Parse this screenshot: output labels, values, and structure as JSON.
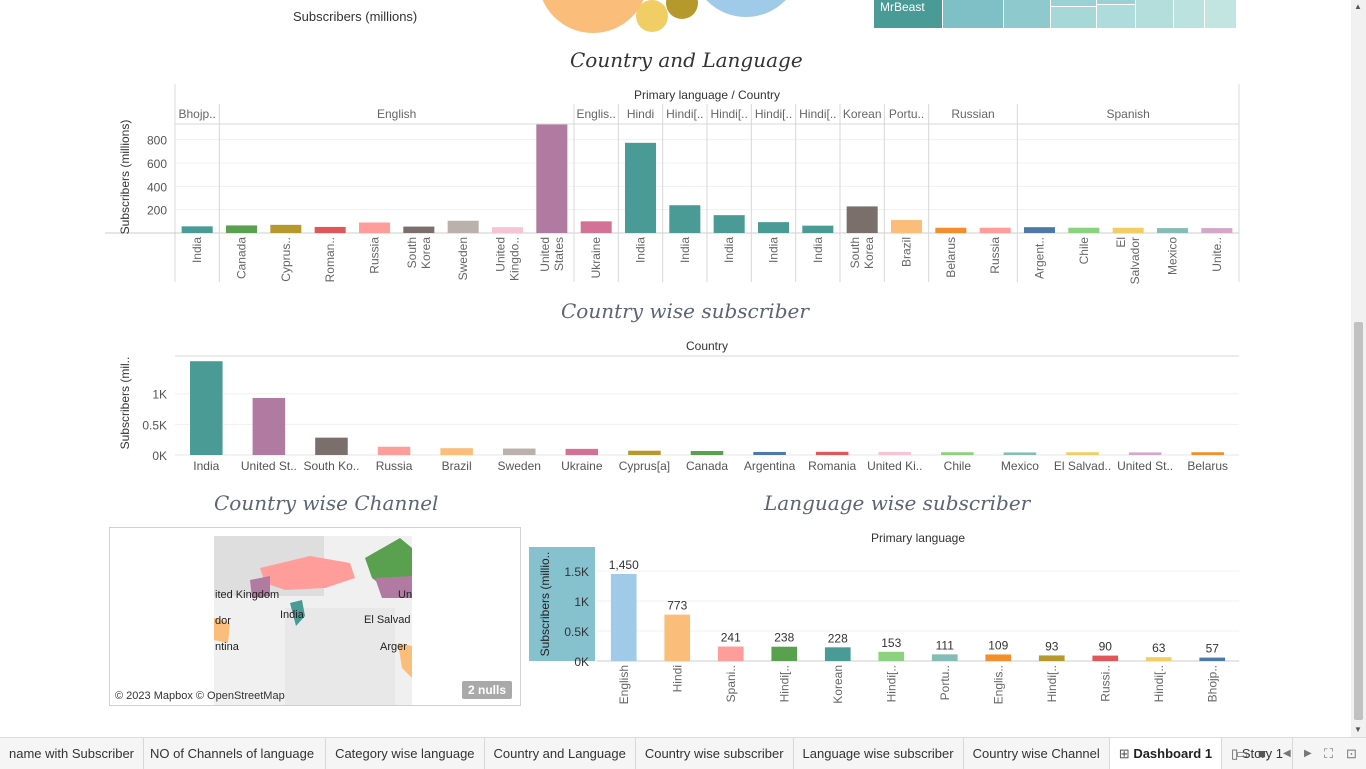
{
  "top_strip": {
    "axis_label": "Subscribers (millions)",
    "treemap_label": "MrBeast"
  },
  "titles": {
    "country_language": "Country and Language",
    "country_subscriber": "Country wise subscriber",
    "country_channel": "Country wise Channel",
    "language_subscriber": "Language wise subscriber"
  },
  "colors": {
    "teal": "#4a9a95",
    "mauve": "#b07aa1",
    "grey_brown": "#7a6f6a",
    "pink": "#ff9d9a",
    "orange": "#fabd7a",
    "taupe": "#bab0ac",
    "rose": "#d37295",
    "olive": "#b6992d",
    "green": "#59a14f",
    "blue": "#4e79a7",
    "red": "#e15759",
    "light_pink": "#f7c4d5",
    "light_green": "#8cd17d",
    "light_teal": "#86bcb6",
    "yellow": "#f1ce63",
    "lavender": "#d4a6c8",
    "dark_orange": "#f28e2b",
    "light_blue": "#a0cbe8",
    "highlight": "#86c2ce"
  },
  "chart_data": [
    {
      "type": "bar",
      "title": "Country and Language",
      "header": "Primary language  /  Country",
      "ylabel": "Subscribers (millions)",
      "yticks": [
        "200",
        "400",
        "600",
        "800"
      ],
      "ylim": [
        0,
        950
      ],
      "groups": [
        {
          "name": "Bhojp..",
          "bars": [
            {
              "x": "India",
              "value": 57,
              "color": "#4a9a95"
            }
          ]
        },
        {
          "name": "English",
          "bars": [
            {
              "x": "Canada",
              "value": 65,
              "color": "#59a14f"
            },
            {
              "x": "Cyprus..",
              "value": 70,
              "color": "#b6992d"
            },
            {
              "x": "Roman..",
              "value": 52,
              "color": "#e15759"
            },
            {
              "x": "Russia",
              "value": 90,
              "color": "#ff9d9a"
            },
            {
              "x": "South Korea",
              "value": 55,
              "color": "#7a6f6a"
            },
            {
              "x": "Sweden",
              "value": 105,
              "color": "#bab0ac"
            },
            {
              "x": "United Kingdo..",
              "value": 50,
              "color": "#f7c4d5"
            },
            {
              "x": "United States",
              "value": 930,
              "color": "#b07aa1"
            }
          ]
        },
        {
          "name": "Englis..",
          "bars": [
            {
              "x": "Ukraine",
              "value": 100,
              "color": "#d37295"
            }
          ]
        },
        {
          "name": "Hindi",
          "bars": [
            {
              "x": "India",
              "value": 773,
              "color": "#4a9a95"
            }
          ]
        },
        {
          "name": "Hindi[..",
          "bars": [
            {
              "x": "India",
              "value": 238,
              "color": "#4a9a95"
            }
          ]
        },
        {
          "name": "Hindi[..",
          "bars": [
            {
              "x": "India",
              "value": 153,
              "color": "#4a9a95"
            }
          ]
        },
        {
          "name": "Hindi[..",
          "bars": [
            {
              "x": "India",
              "value": 93,
              "color": "#4a9a95"
            }
          ]
        },
        {
          "name": "Hindi[..",
          "bars": [
            {
              "x": "India",
              "value": 63,
              "color": "#4a9a95"
            }
          ]
        },
        {
          "name": "Korean",
          "bars": [
            {
              "x": "South Korea",
              "value": 228,
              "color": "#7a6f6a"
            }
          ]
        },
        {
          "name": "Portu..",
          "bars": [
            {
              "x": "Brazil",
              "value": 111,
              "color": "#fabd7a"
            }
          ]
        },
        {
          "name": "Russian",
          "bars": [
            {
              "x": "Belarus",
              "value": 45,
              "color": "#f28e2b"
            },
            {
              "x": "Russia",
              "value": 45,
              "color": "#ff9d9a"
            }
          ]
        },
        {
          "name": "Spanish",
          "bars": [
            {
              "x": "Argent..",
              "value": 50,
              "color": "#4e79a7"
            },
            {
              "x": "Chile",
              "value": 45,
              "color": "#8cd17d"
            },
            {
              "x": "El Salvador",
              "value": 45,
              "color": "#f1ce63"
            },
            {
              "x": "Mexico",
              "value": 42,
              "color": "#86bcb6"
            },
            {
              "x": "Unite..",
              "value": 42,
              "color": "#d4a6c8"
            }
          ]
        }
      ]
    },
    {
      "type": "bar",
      "title": "Country wise subscriber",
      "header": "Country",
      "ylabel": "Subscribers (mil..",
      "yticks": [
        "0K",
        "0.5K",
        "1K"
      ],
      "ylim": [
        0,
        1550
      ],
      "categories": [
        "India",
        "United St..",
        "South Ko..",
        "Russia",
        "Brazil",
        "Sweden",
        "Ukraine",
        "Cyprus[a]",
        "Canada",
        "Argentina",
        "Romania",
        "United Ki..",
        "Chile",
        "Mexico",
        "El Salvad..",
        "United St..",
        "Belarus"
      ],
      "values": [
        1530,
        930,
        283,
        135,
        111,
        105,
        100,
        70,
        65,
        50,
        52,
        50,
        45,
        42,
        45,
        42,
        45
      ],
      "colors": [
        "#4a9a95",
        "#b07aa1",
        "#7a6f6a",
        "#ff9d9a",
        "#fabd7a",
        "#bab0ac",
        "#d37295",
        "#b6992d",
        "#59a14f",
        "#4e79a7",
        "#e15759",
        "#f7c4d5",
        "#8cd17d",
        "#86bcb6",
        "#f1ce63",
        "#d4a6c8",
        "#f28e2b"
      ]
    },
    {
      "type": "bar",
      "title": "Language wise subscriber",
      "header": "Primary language",
      "ylabel": "Subscribers (millio..",
      "yticks": [
        "0K",
        "0.5K",
        "1K",
        "1.5K"
      ],
      "ylim": [
        0,
        1750
      ],
      "categories": [
        "English",
        "Hindi",
        "Spani..",
        "Hindi[..",
        "Korean",
        "Hindi[..",
        "Portu..",
        "Englis..",
        "Hindi[..",
        "Russi..",
        "Hindi[..",
        "Bhojp.."
      ],
      "values": [
        1450,
        773,
        241,
        238,
        228,
        153,
        111,
        109,
        93,
        90,
        63,
        57
      ],
      "labels": [
        "1,450",
        "773",
        "241",
        "238",
        "228",
        "153",
        "111",
        "109",
        "93",
        "90",
        "63",
        "57"
      ],
      "colors": [
        "#a0cbe8",
        "#fabd7a",
        "#ff9d9a",
        "#59a14f",
        "#4a9a95",
        "#8cd17d",
        "#86bcb6",
        "#f28e2b",
        "#b6992d",
        "#e15759",
        "#f1ce63",
        "#4e79a7"
      ]
    }
  ],
  "map": {
    "labels": [
      "ited Kingdom",
      "India",
      "El Salvad",
      "dor",
      "Arger",
      "ntina",
      "Un"
    ],
    "attribution": "© 2023 Mapbox © OpenStreetMap",
    "nulls": "2 nulls"
  },
  "tabs": [
    {
      "label": "name with Subscriber",
      "active": false
    },
    {
      "label": "NO of Channels of language",
      "active": false
    },
    {
      "label": "Category wise language",
      "active": false
    },
    {
      "label": "Country and Language",
      "active": false
    },
    {
      "label": "Country wise subscriber",
      "active": false
    },
    {
      "label": "Language wise subscriber",
      "active": false
    },
    {
      "label": "Country wise Channel",
      "active": false
    },
    {
      "label": "Dashboard 1",
      "active": true,
      "icon": "dashboard-icon"
    },
    {
      "label": "Story 1",
      "active": false,
      "icon": "story-icon"
    }
  ]
}
